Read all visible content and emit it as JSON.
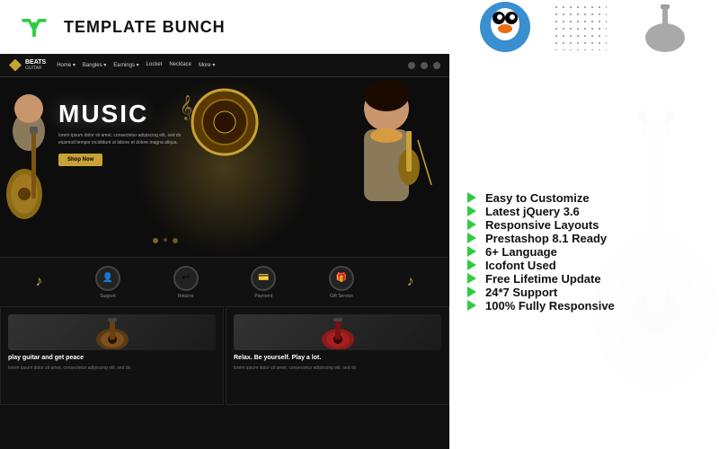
{
  "header": {
    "logo_text": "TEMPLATE BUNCH",
    "logo_icon": "TB"
  },
  "site_nav": {
    "logo": "BEATS",
    "sublogo": "GUITAR",
    "links": [
      "Home",
      "Bangles",
      "Earnings",
      "Locket",
      "Necklace",
      "More"
    ],
    "icons": [
      "search",
      "user",
      "cart"
    ]
  },
  "hero": {
    "title": "MUSIC",
    "description": "lorem ipsum dolor sit amet, consectetur adipiscing elit, sed do eiusmod tempor incididunt ut labore et dolore magna aliqua.",
    "button_label": "Shop Now"
  },
  "feature_icons": [
    {
      "label": "Support",
      "icon": "👤"
    },
    {
      "label": "Returns",
      "icon": "↩"
    },
    {
      "label": "Payment",
      "icon": "💳"
    },
    {
      "label": "Gift Service",
      "icon": "🎁"
    }
  ],
  "products": [
    {
      "title": "play guitar and get peace",
      "description": "lorem ipsum dolor sit amet, consectetur adipiscing elit, sed do"
    },
    {
      "title": "Relax. Be yourself. Play a lot.",
      "description": "lorem ipsum dolor sit amet, consectetur adipiscing elit, sed do"
    }
  ],
  "features": [
    {
      "label": "Easy to Customize"
    },
    {
      "label": "Latest jQuery 3.6"
    },
    {
      "label": "Responsive Layouts"
    },
    {
      "label": "Prestashop 8.1 Ready"
    },
    {
      "label": "6+ Language"
    },
    {
      "label": "Icofont Used"
    },
    {
      "label": "Free Lifetime Update"
    },
    {
      "label": "24*7 Support"
    },
    {
      "label": "100% Fully Responsive"
    }
  ]
}
